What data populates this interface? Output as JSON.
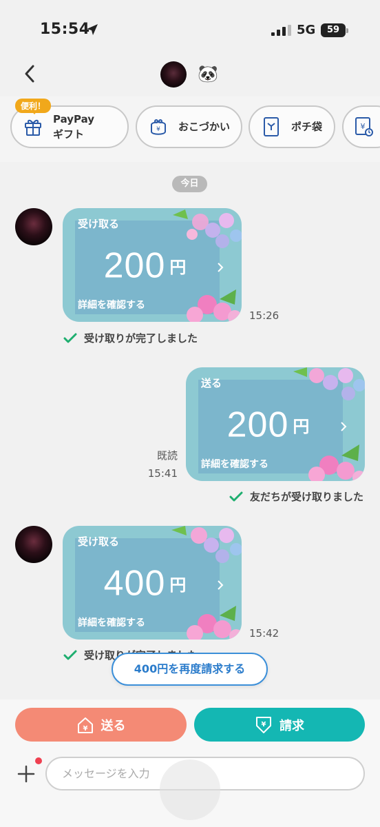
{
  "status_bar": {
    "time": "15:54",
    "network": "5G",
    "battery": "59"
  },
  "header": {
    "contact_emoji": "🐼"
  },
  "quick_actions": {
    "badge": "便利！",
    "items": [
      {
        "label": "PayPay\nギフト",
        "icon": "gift-icon"
      },
      {
        "label": "おこづかい",
        "icon": "coin-purse-icon"
      },
      {
        "label": "ポチ袋",
        "icon": "envelope-icon"
      },
      {
        "label": "",
        "icon": "yen-clock-icon"
      }
    ]
  },
  "date_chip": "今日",
  "messages": [
    {
      "side": "left",
      "action": "受け取る",
      "amount": "200",
      "currency": "円",
      "detail": "詳細を確認する",
      "time": "15:26",
      "status": "受け取りが完了しました"
    },
    {
      "side": "right",
      "action": "送る",
      "amount": "200",
      "currency": "円",
      "detail": "詳細を確認する",
      "read_label": "既読",
      "time": "15:41",
      "status": "友だちが受け取りました"
    },
    {
      "side": "left",
      "action": "受け取る",
      "amount": "400",
      "currency": "円",
      "detail": "詳細を確認する",
      "time": "15:42",
      "status": "受け取りが完了しました"
    }
  ],
  "rerequest_label": "400円を再度請求する",
  "bottom": {
    "send_label": "送る",
    "request_label": "請求",
    "message_placeholder": "メッセージを入力"
  },
  "colors": {
    "send": "#f48a75",
    "request": "#14b7b3",
    "card": "#7cb6cc",
    "check": "#1eae6f",
    "link": "#2b7ccb"
  }
}
